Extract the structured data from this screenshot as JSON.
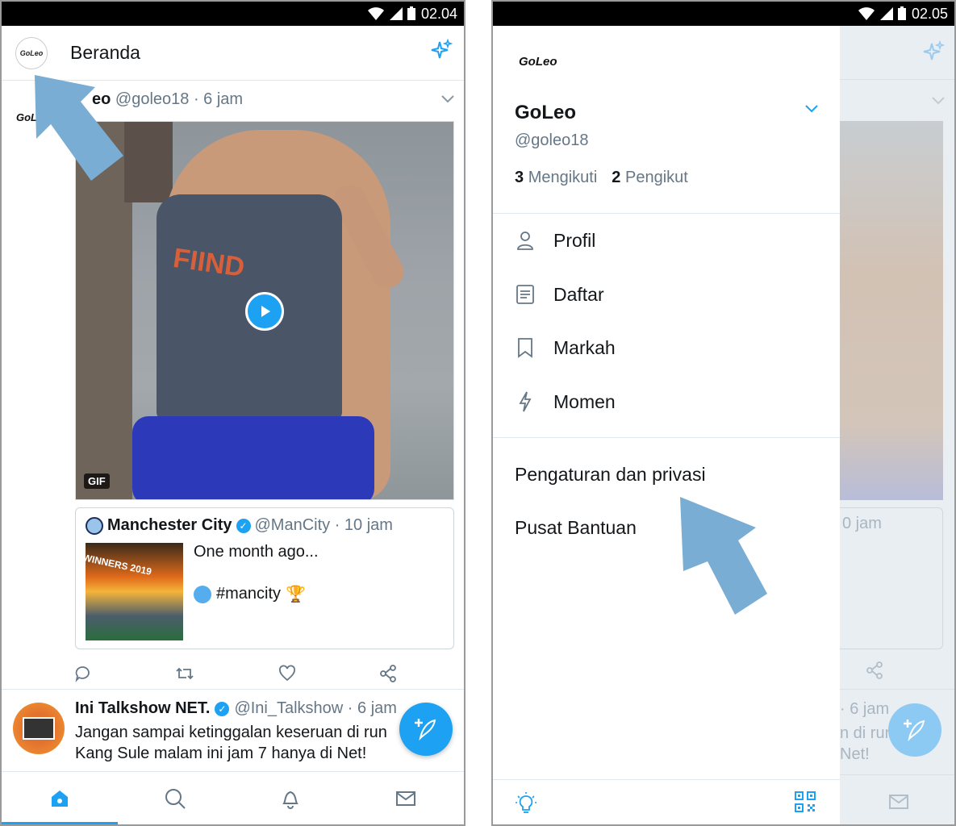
{
  "left": {
    "status": {
      "time": "02.04"
    },
    "header": {
      "title": "Beranda",
      "avatar_text": "GoLeo"
    },
    "tweet1": {
      "avatar_logo": "GoLeo",
      "name_partial": "eo",
      "meta": "@goleo18 · 6 jam",
      "gif_badge": "GIF",
      "gif_print": "FIIND",
      "quote": {
        "name": "Manchester City",
        "meta": "@ManCity · 10 jam",
        "text1": "One month ago...",
        "hashtag": "#mancity",
        "trophy": "🏆",
        "image_caption": "WINNERS 2019"
      }
    },
    "tweet2": {
      "name": "Ini Talkshow NET.",
      "meta": "@Ini_Talkshow · 6 jam",
      "line1": "Jangan sampai ketinggalan keseruan di run",
      "line2": "Kang Sule malam ini jam 7 hanya di Net!"
    }
  },
  "right": {
    "status": {
      "time": "02.05"
    },
    "drawer": {
      "logo": "GoLeo",
      "name": "GoLeo",
      "handle": "@goleo18",
      "following_count": "3",
      "following_label": "Mengikuti",
      "followers_count": "2",
      "followers_label": "Pengikut",
      "menu": [
        {
          "label": "Profil",
          "icon": "person-icon"
        },
        {
          "label": "Daftar",
          "icon": "list-icon"
        },
        {
          "label": "Markah",
          "icon": "bookmark-icon"
        },
        {
          "label": "Momen",
          "icon": "lightning-icon"
        }
      ],
      "settings": "Pengaturan dan privasi",
      "help": "Pusat Bantuan"
    },
    "background": {
      "quote_meta": "0 jam",
      "tweet2_meta": "· 6 jam",
      "line1": "n di run",
      "line2": "Net!"
    }
  },
  "colors": {
    "accent": "#1da1f2",
    "arrow": "#79add4"
  }
}
